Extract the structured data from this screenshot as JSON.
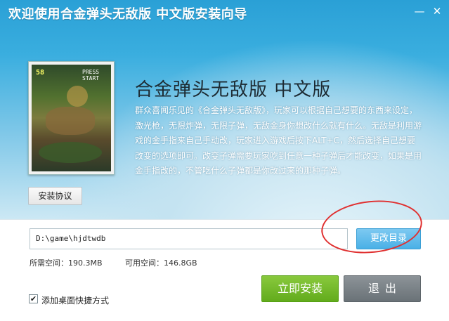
{
  "window": {
    "title": "欢迎使用合金弹头无敌版  中文版安装向导",
    "minimize_glyph": "—",
    "close_glyph": "✕"
  },
  "game_screenshot": {
    "score_text": "58",
    "start_text": "PRESS START"
  },
  "product": {
    "title": "合金弹头无敌版  中文版",
    "description": "群众喜闻乐见的《合金弹头无敌版》，玩家可以根据自己想要的东西来设定，激光枪，无限炸弹，无限子弹，无敌金身你想改什么就有什么。无敌是利用游戏的金手指来自己手动改，玩家进入游戏后按下ALT+C，然后选择自己想要改变的选项即可。改变子弹需要玩家吃到任意一种子弹后才能改变，如果是用金手指改的，不管吃什么子弹都是你改过来的那种子弹。"
  },
  "buttons": {
    "agreement": "安装协议",
    "change_dir": "更改目录",
    "install": "立即安装",
    "exit": "退出"
  },
  "install_path": "D:\\game\\hjdtwdb",
  "space": {
    "required": "所需空间：190.3MB",
    "available": "可用空间：146.8GB"
  },
  "shortcut": {
    "label": "添加桌面快捷方式",
    "checked": true,
    "check_glyph": "✔"
  },
  "colors": {
    "header_blue": "#2aa0d6",
    "install_green": "#6fb52a",
    "exit_gray": "#7b8388",
    "change_dir_blue": "#5bb9ea",
    "annotation_red": "#e03030"
  }
}
